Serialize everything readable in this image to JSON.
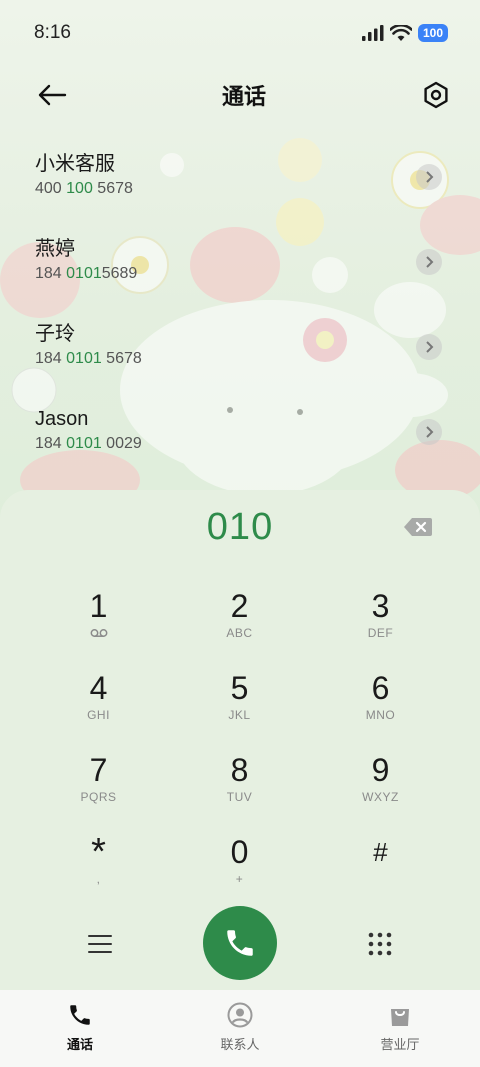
{
  "status_bar": {
    "time": "8:16",
    "battery": "100"
  },
  "header": {
    "title": "通话"
  },
  "contacts": [
    {
      "name": "小米客服",
      "number_parts": [
        "400 ",
        "100",
        " 5678"
      ]
    },
    {
      "name": "燕婷",
      "number_parts": [
        "184 ",
        "0101",
        "5689"
      ]
    },
    {
      "name": "子玲",
      "number_parts": [
        "184 ",
        "0101",
        " 5678"
      ]
    },
    {
      "name": "Jason",
      "number_parts": [
        "184 ",
        "0101",
        " 0029"
      ]
    }
  ],
  "dialer": {
    "display": "010",
    "keys": [
      {
        "digit": "1",
        "letters": ""
      },
      {
        "digit": "2",
        "letters": "ABC"
      },
      {
        "digit": "3",
        "letters": "DEF"
      },
      {
        "digit": "4",
        "letters": "GHI"
      },
      {
        "digit": "5",
        "letters": "JKL"
      },
      {
        "digit": "6",
        "letters": "MNO"
      },
      {
        "digit": "7",
        "letters": "PQRS"
      },
      {
        "digit": "8",
        "letters": "TUV"
      },
      {
        "digit": "9",
        "letters": "WXYZ"
      },
      {
        "digit": "*",
        "letters": ","
      },
      {
        "digit": "0",
        "letters": "+"
      },
      {
        "digit": "#",
        "letters": ""
      }
    ]
  },
  "nav": [
    {
      "label": "通话",
      "icon": "phone-icon",
      "active": true
    },
    {
      "label": "联系人",
      "icon": "person-icon",
      "active": false
    },
    {
      "label": "营业厅",
      "icon": "bag-icon",
      "active": false
    }
  ],
  "colors": {
    "accent": "#2e8b4a",
    "background": "#e6f0e1",
    "battery": "#3a82f7"
  }
}
